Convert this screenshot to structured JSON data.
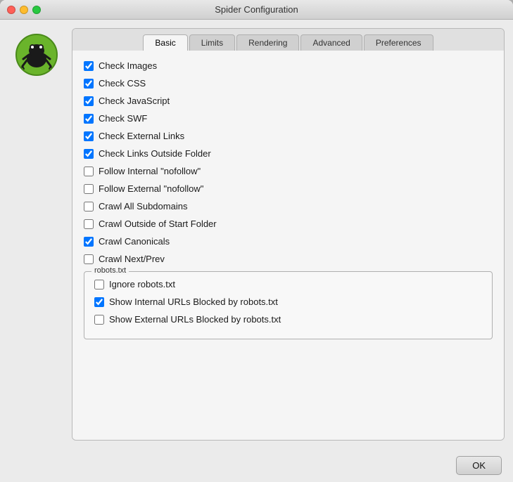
{
  "window": {
    "title": "Spider Configuration"
  },
  "tabs": [
    {
      "id": "basic",
      "label": "Basic",
      "active": true
    },
    {
      "id": "limits",
      "label": "Limits",
      "active": false
    },
    {
      "id": "rendering",
      "label": "Rendering",
      "active": false
    },
    {
      "id": "advanced",
      "label": "Advanced",
      "active": false
    },
    {
      "id": "preferences",
      "label": "Preferences",
      "active": false
    }
  ],
  "checkboxes": [
    {
      "id": "check-images",
      "label": "Check Images",
      "checked": true
    },
    {
      "id": "check-css",
      "label": "Check CSS",
      "checked": true
    },
    {
      "id": "check-javascript",
      "label": "Check JavaScript",
      "checked": true
    },
    {
      "id": "check-swf",
      "label": "Check SWF",
      "checked": true
    },
    {
      "id": "check-external-links",
      "label": "Check External Links",
      "checked": true
    },
    {
      "id": "check-links-outside-folder",
      "label": "Check Links Outside Folder",
      "checked": true
    },
    {
      "id": "follow-internal-nofollow",
      "label": "Follow Internal \"nofollow\"",
      "checked": false
    },
    {
      "id": "follow-external-nofollow",
      "label": "Follow External \"nofollow\"",
      "checked": false
    },
    {
      "id": "crawl-all-subdomains",
      "label": "Crawl All Subdomains",
      "checked": false
    },
    {
      "id": "crawl-outside-start-folder",
      "label": "Crawl Outside of Start Folder",
      "checked": false
    },
    {
      "id": "crawl-canonicals",
      "label": "Crawl Canonicals",
      "checked": true
    },
    {
      "id": "crawl-next-prev",
      "label": "Crawl Next/Prev",
      "checked": false
    }
  ],
  "robots_group": {
    "label": "robots.txt",
    "items": [
      {
        "id": "ignore-robots",
        "label": "Ignore robots.txt",
        "checked": false
      },
      {
        "id": "show-internal-blocked",
        "label": "Show Internal URLs Blocked by robots.txt",
        "checked": true
      },
      {
        "id": "show-external-blocked",
        "label": "Show External URLs Blocked by robots.txt",
        "checked": false
      }
    ]
  },
  "footer": {
    "ok_label": "OK"
  }
}
